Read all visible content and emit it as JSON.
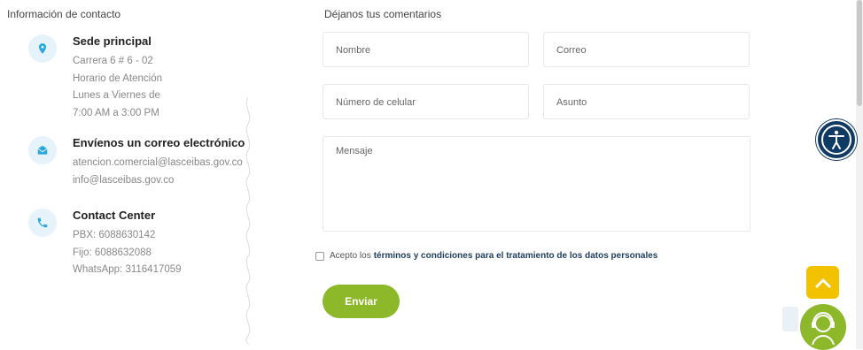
{
  "contact_info": {
    "title": "Información de contacto",
    "items": [
      {
        "heading": "Sede principal",
        "icon": "location-pin-icon",
        "lines": [
          "Carrera 6 # 6 - 02",
          "Horario de Atención",
          "Lunes a Viernes de",
          "7:00 AM a 3:00 PM"
        ]
      },
      {
        "heading": "Envíenos un correo electrónico",
        "icon": "envelope-icon",
        "lines": [
          "atencion.comercial@lasceibas.gov.co",
          "info@lasceibas.gov.co"
        ]
      },
      {
        "heading": "Contact Center",
        "icon": "phone-icon",
        "lines": [
          "PBX: 6088630142",
          "Fijo: 6088632088",
          "WhatsApp: 3116417059"
        ]
      }
    ]
  },
  "form": {
    "title": "Déjanos tus comentarios",
    "name_placeholder": "Nombre",
    "email_placeholder": "Correo",
    "phone_placeholder": "Número de celular",
    "subject_placeholder": "Asunto",
    "message_placeholder": "Mensaje",
    "consent_prefix": "Acepto los",
    "consent_link": "términos y condiciones para el tratamiento de los datos personales",
    "submit_label": "Enviar"
  },
  "colors": {
    "accent_blue": "#29a8e0",
    "icon_bg": "#e6f3fb",
    "button_green": "#8db82a",
    "link_navy": "#1d3d5c",
    "scroll_top_yellow": "#f2c200",
    "accessibility_navy": "#0e3a63"
  },
  "floating": {
    "accessibility_icon": "accessibility-person-icon",
    "scroll_top_icon": "chevron-up-icon",
    "support_icon": "headset-agent-icon"
  }
}
